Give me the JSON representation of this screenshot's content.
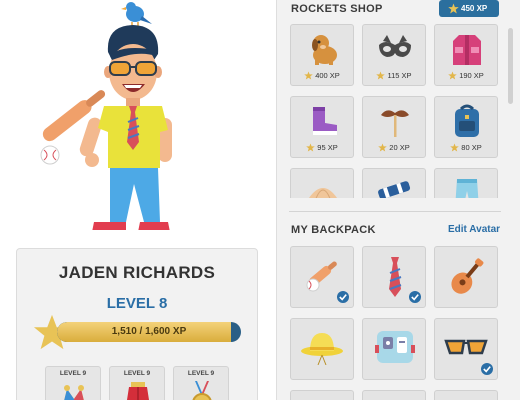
{
  "player": {
    "name": "JADEN RICHARDS",
    "level": "LEVEL 8",
    "xp_text": "1,510 / 1,600 XP",
    "xp_progress": 0.944
  },
  "badges": [
    {
      "label": "LEVEL 9",
      "icon": "jester-hat-icon"
    },
    {
      "label": "LEVEL 9",
      "icon": "red-cape-icon"
    },
    {
      "label": "LEVEL 9",
      "icon": "medal-icon"
    }
  ],
  "shop": {
    "title": "ROCKETS SHOP",
    "balance": "450 XP",
    "items": [
      {
        "icon": "dog-icon",
        "price": "400 XP"
      },
      {
        "icon": "mask-icon",
        "price": "115 XP"
      },
      {
        "icon": "jacket-icon",
        "price": "190 XP"
      },
      {
        "icon": "boot-icon",
        "price": "95 XP"
      },
      {
        "icon": "mustache-icon",
        "price": "20 XP"
      },
      {
        "icon": "backpack-icon",
        "price": "80 XP"
      },
      {
        "icon": "umbrella-icon",
        "price": ""
      },
      {
        "icon": "telescope-icon",
        "price": ""
      },
      {
        "icon": "pants-icon",
        "price": ""
      }
    ]
  },
  "backpack": {
    "title": "MY BACKPACK",
    "edit_label": "Edit Avatar",
    "items": [
      {
        "icon": "baseball-bat-icon",
        "equipped": true
      },
      {
        "icon": "necktie-icon",
        "equipped": true
      },
      {
        "icon": "guitar-icon",
        "equipped": false
      },
      {
        "icon": "sun-hat-icon",
        "equipped": false
      },
      {
        "icon": "robot-icon",
        "equipped": false
      },
      {
        "icon": "sunglasses-icon",
        "equipped": true
      }
    ]
  },
  "colors": {
    "accent_blue": "#2a6ea6",
    "gold": "#e2b64a",
    "panel_bg": "#f2f2f2"
  }
}
